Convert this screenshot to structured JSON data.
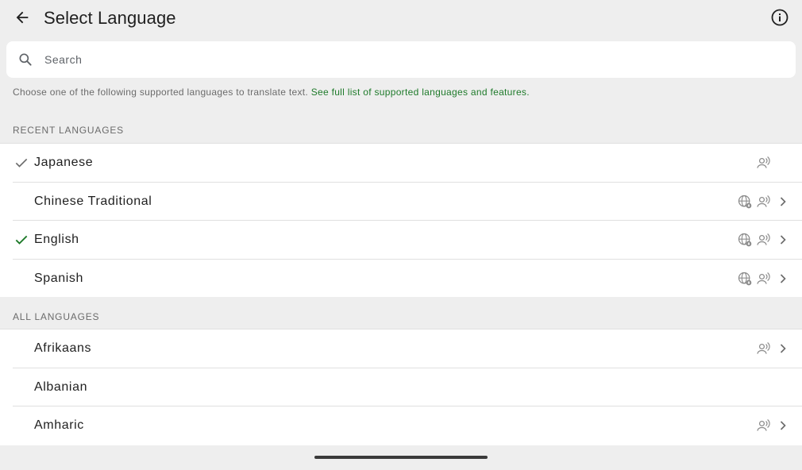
{
  "header": {
    "title": "Select Language",
    "back_icon": "arrow-left-icon",
    "info_icon": "info-circle-icon"
  },
  "search": {
    "placeholder": "Search",
    "value": ""
  },
  "helper": {
    "text": "Choose one of the following supported languages to translate text.",
    "link_text": "See full list of supported languages and features."
  },
  "sections": {
    "recent_title": "RECENT LANGUAGES",
    "all_title": "ALL LANGUAGES"
  },
  "recent_languages": [
    {
      "label": "Japanese",
      "check": "grey",
      "offline": false,
      "voice": true,
      "chevron": false
    },
    {
      "label": "Chinese Traditional",
      "check": "none",
      "offline": true,
      "voice": true,
      "chevron": true
    },
    {
      "label": "English",
      "check": "green",
      "offline": true,
      "voice": true,
      "chevron": true
    },
    {
      "label": "Spanish",
      "check": "none",
      "offline": true,
      "voice": true,
      "chevron": true
    }
  ],
  "all_languages": [
    {
      "label": "Afrikaans",
      "check": "none",
      "offline": false,
      "voice": true,
      "chevron": true
    },
    {
      "label": "Albanian",
      "check": "none",
      "offline": false,
      "voice": false,
      "chevron": false
    },
    {
      "label": "Amharic",
      "check": "none",
      "offline": false,
      "voice": true,
      "chevron": true
    }
  ],
  "colors": {
    "accent_green": "#1e7a2a",
    "check_grey": "#6b6b6b",
    "icon_grey": "#8a8a8a",
    "background": "#eeeeee"
  }
}
